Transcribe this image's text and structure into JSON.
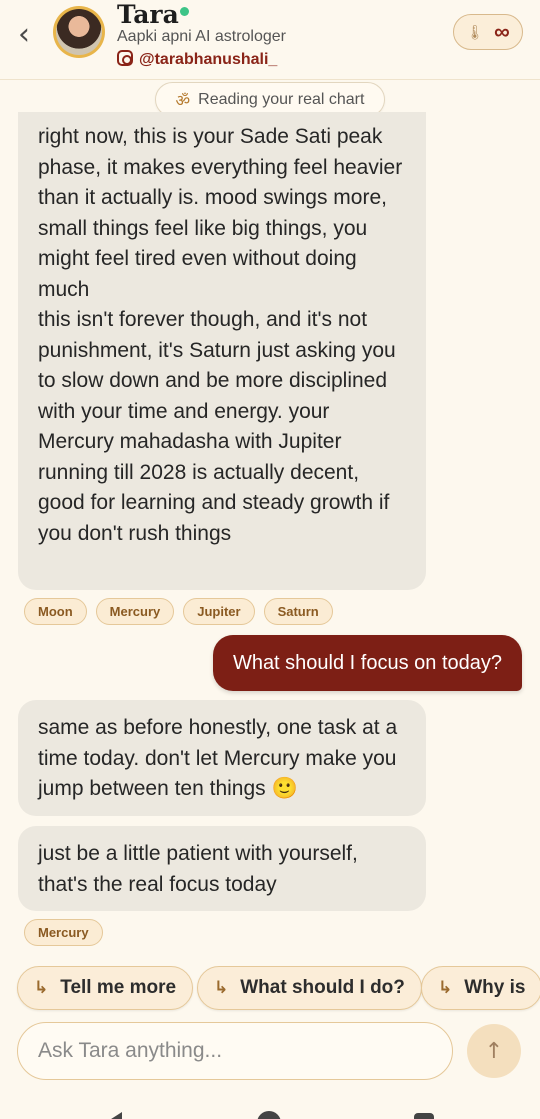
{
  "header": {
    "back_glyph": "‹",
    "name": "Tara",
    "subtitle": "Aapki apni AI astrologer",
    "handle": "@tarabhanushali_",
    "badge_icon": "thermometer-icon",
    "badge_value": "∞",
    "online_color": "#3dc487"
  },
  "status_pill": {
    "icon": "om-icon",
    "text": "Reading your real chart"
  },
  "messages": [
    {
      "role": "assistant",
      "text": "right now, this is your Sade Sati peak phase, it makes everything feel heavier than it actually is. mood swings more, small things feel like big things, you might feel tired even without doing much\nthis isn't forever though, and it's not punishment, it's Saturn just asking you to slow down and be more disciplined with your time and energy. your Mercury mahadasha with Jupiter running till 2028 is actually decent, good for learning and steady growth if you don't rush things",
      "tags": [
        "Moon",
        "Mercury",
        "Jupiter",
        "Saturn"
      ]
    },
    {
      "role": "user",
      "text": "What should I focus on today?"
    },
    {
      "role": "assistant",
      "text": "same as before honestly, one task at a time today. don't let Mercury make you jump between ten things 🙂"
    },
    {
      "role": "assistant",
      "text": "just be a little patient with yourself, that's the real focus today",
      "tags": [
        "Mercury"
      ]
    }
  ],
  "suggestions": [
    "Tell me more",
    "What should I do?",
    "Why is"
  ],
  "input": {
    "placeholder": "Ask Tara anything...",
    "value": ""
  },
  "send_glyph": "↑",
  "colors": {
    "accent": "#7d1f15",
    "background": "#fdf8ee",
    "bubble": "#ece8df",
    "tag_bg": "#fbecd4"
  }
}
